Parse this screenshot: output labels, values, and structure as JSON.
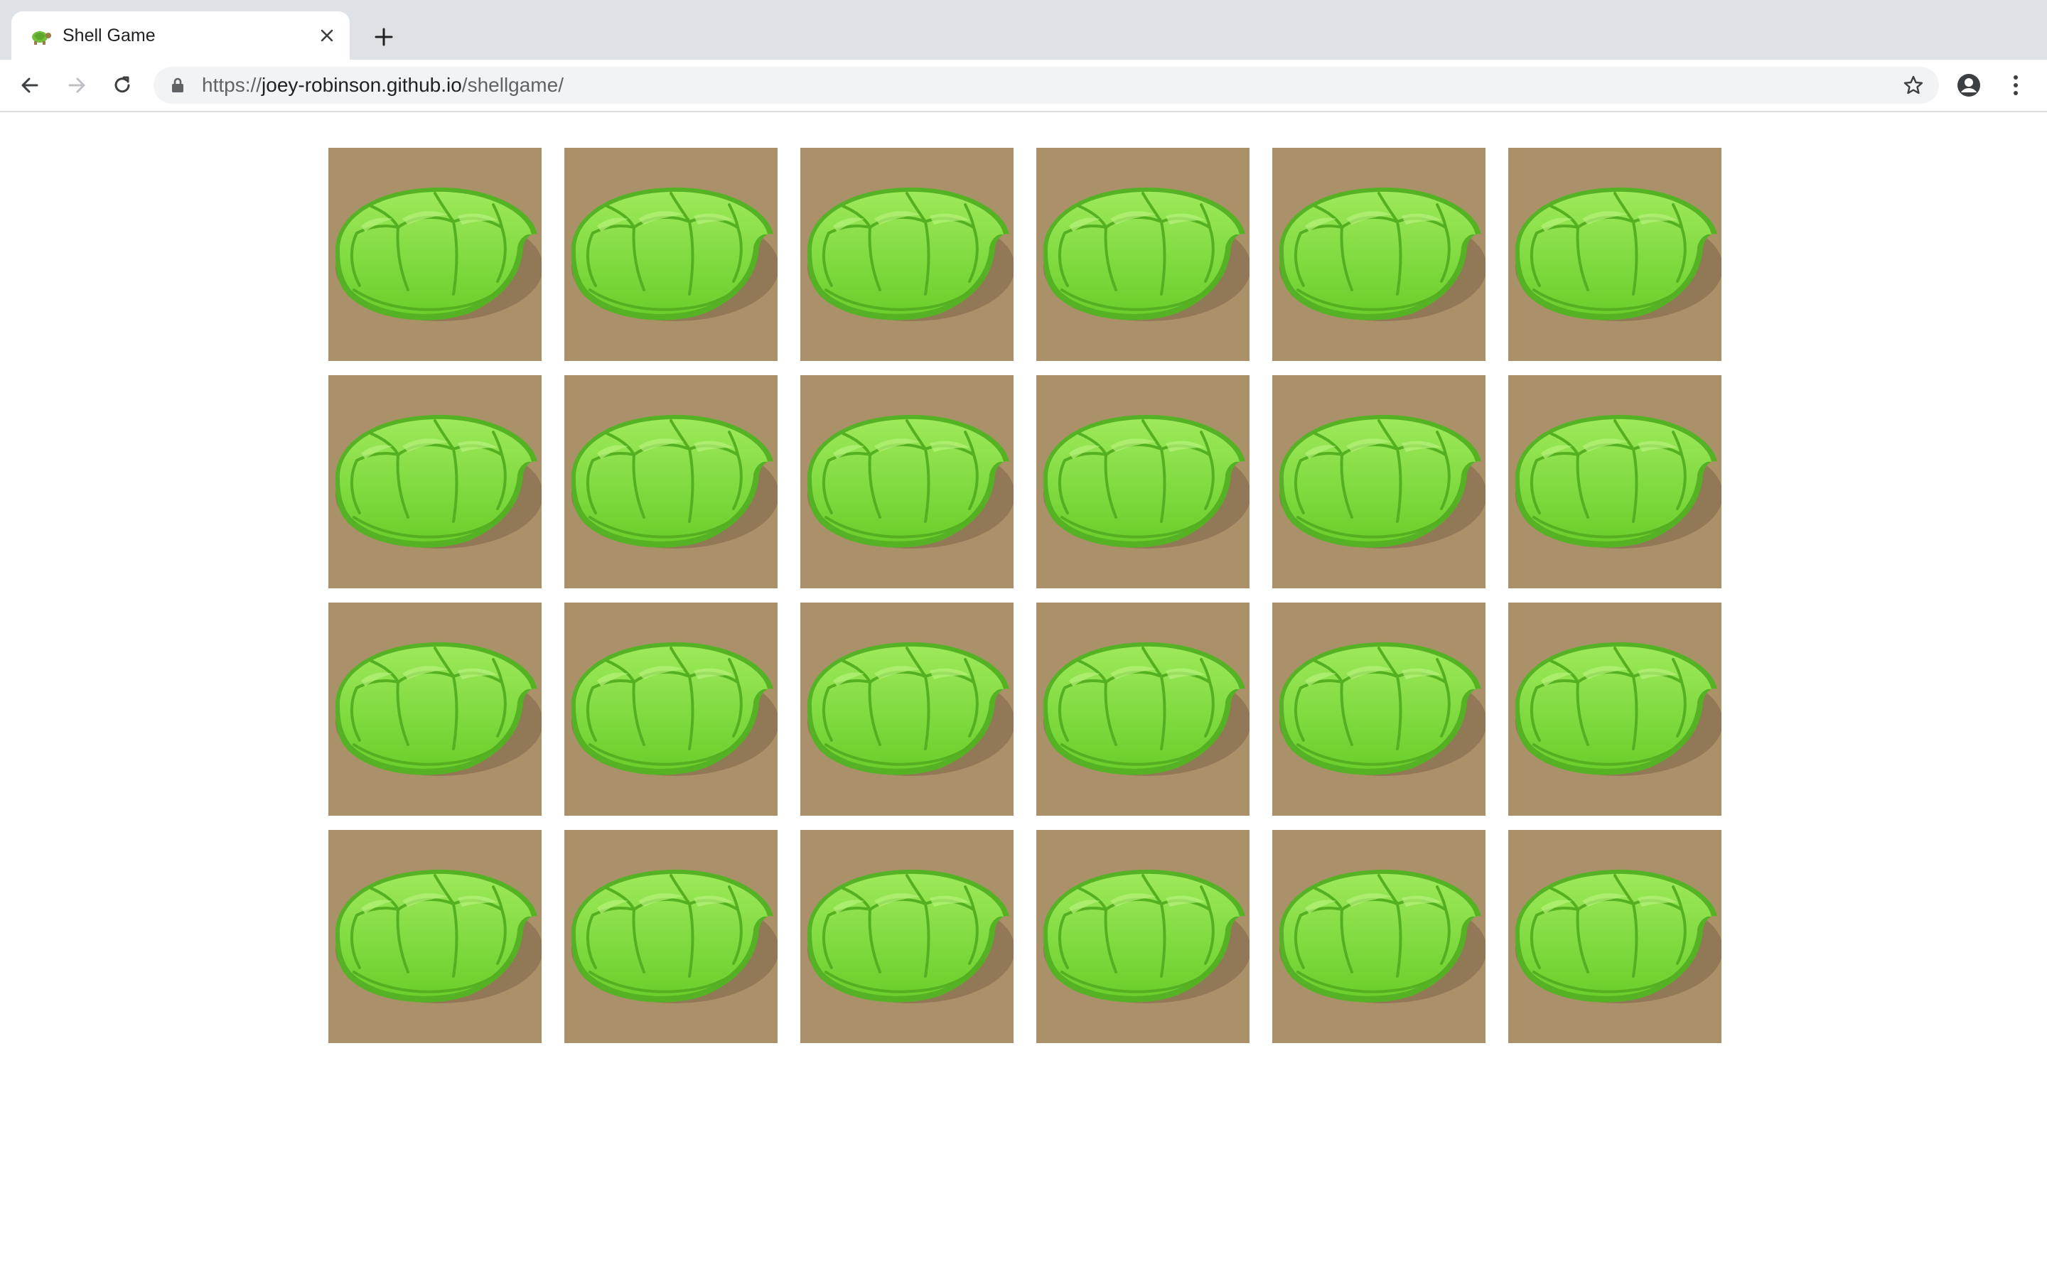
{
  "browser": {
    "tab_title": "Shell Game",
    "url_scheme": "https://",
    "url_host": "joey-robinson.github.io",
    "url_path": "/shellgame/",
    "favicon": "turtle-icon"
  },
  "colors": {
    "tile": "#ab916a",
    "shell_light": "#8ee24a",
    "shell_dark": "#4faa1e",
    "shadow": "#7b6545"
  },
  "game": {
    "rows": 4,
    "columns": 6,
    "tile_icon": "turtle-shell-icon"
  }
}
